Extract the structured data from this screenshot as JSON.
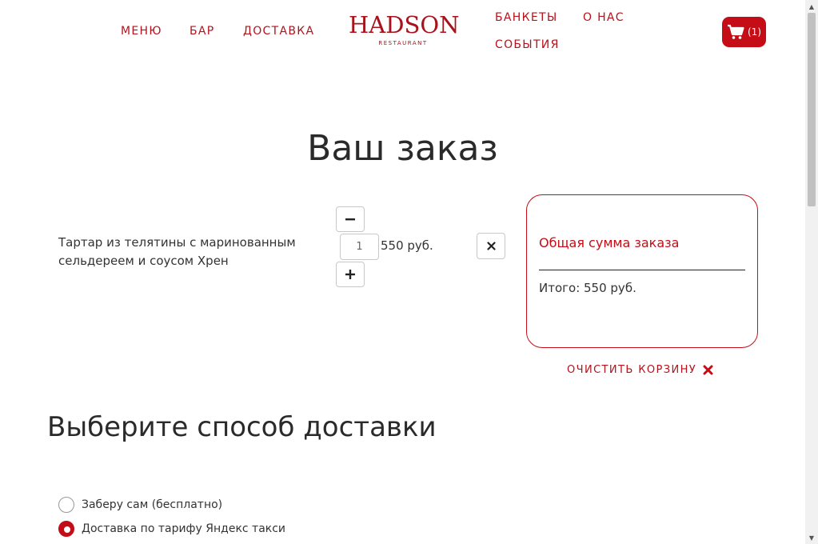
{
  "nav": {
    "left": [
      "МЕНЮ",
      "БАР",
      "ДОСТАВКА"
    ],
    "right_top": [
      "БАНКЕТЫ",
      "О НАС"
    ],
    "right_bottom": [
      "СОБЫТИЯ"
    ]
  },
  "logo": {
    "main": "HADSON",
    "sub": "RESTAURANT"
  },
  "cart": {
    "count": "(1)",
    "icon": "cart-icon"
  },
  "page_title": "Ваш заказ",
  "order": {
    "items": [
      {
        "name": "Тартар из телятины с маринованным сельдереем и соусом Хрен",
        "quantity": "1",
        "price": "550 руб."
      }
    ]
  },
  "summary": {
    "title": "Общая сумма заказа",
    "total": "Итого: 550 руб."
  },
  "clear_cart_label": "ОЧИСТИТЬ КОРЗИНУ",
  "delivery": {
    "title": "Выберите способ доставки",
    "options": [
      {
        "label": "Заберу сам (бесплатно)",
        "selected": false
      },
      {
        "label": "Доставка по тарифу Яндекс такси",
        "selected": true
      }
    ]
  },
  "colors": {
    "accent": "#c40d16",
    "text": "#2a2a2a"
  }
}
